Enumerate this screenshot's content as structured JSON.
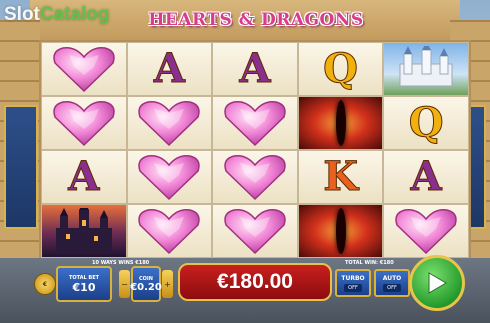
{
  "watermark": {
    "part1": "Slot",
    "part2": "Catalog"
  },
  "game": {
    "title": "HEARTS & DRAGONS"
  },
  "reels": {
    "symbols": [
      [
        "heart",
        "A",
        "A",
        "Q",
        "castle-white"
      ],
      [
        "heart",
        "heart",
        "heart",
        "eye",
        "Q"
      ],
      [
        "A",
        "heart",
        "heart",
        "K",
        "A"
      ],
      [
        "castle-dark",
        "heart",
        "heart",
        "eye",
        "heart"
      ]
    ]
  },
  "info": {
    "ways_wins": "10 WAYS WINS €180",
    "total_win": "TOTAL WIN: €180"
  },
  "controls": {
    "total_bet_label": "TOTAL BET",
    "total_bet_value": "€10",
    "coin_label": "COIN",
    "coin_value": "€0.20",
    "win_amount": "€180.00",
    "turbo_label": "TURBO",
    "turbo_value": "OFF",
    "auto_label": "AUTO",
    "auto_value": "OFF",
    "minus": "−",
    "plus": "+"
  },
  "colors": {
    "accent": "#d9b13c",
    "win_box": "#c8201d",
    "spin": "#259b2c"
  }
}
